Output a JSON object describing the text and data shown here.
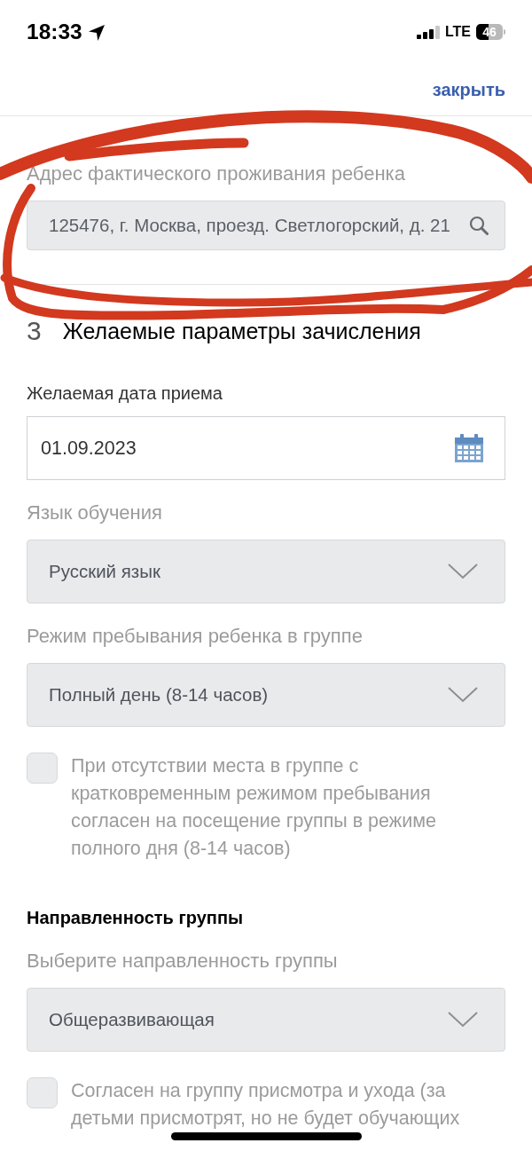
{
  "status_bar": {
    "time": "18:33",
    "network": "LTE",
    "battery": "46"
  },
  "header": {
    "close_link": "закрыть"
  },
  "address": {
    "label": "Адрес фактического проживания ребенка",
    "value": "125476, г. Москва, проезд. Светлогорский, д. 21",
    "disabled": true
  },
  "section": {
    "number": "3",
    "title": "Желаемые параметры зачисления"
  },
  "fields": [
    {
      "kind": "date",
      "label": "Желаемая дата приема",
      "value": "01.09.2023",
      "disabled": false
    },
    {
      "kind": "select",
      "label": "Язык обучения",
      "value": "Русский язык",
      "disabled": true
    },
    {
      "kind": "select",
      "label": "Режим пребывания ребенка в группе",
      "value": "Полный день (8-14 часов)",
      "disabled": true
    },
    {
      "kind": "checkbox",
      "label": "При отсутствии места в группе с кратковременным режимом пребывания согласен на посещение группы в режиме полного дня (8-14 часов)",
      "checked": false,
      "disabled": true
    },
    {
      "kind": "heading",
      "label": "Направленность группы"
    },
    {
      "kind": "select",
      "label": "Выберите направленность группы",
      "value": "Общеразвивающая",
      "disabled": true
    },
    {
      "kind": "checkbox",
      "label": "Согласен на группу присмотра и ухода (за детьми присмотрят, но не будет обучающих",
      "checked": false,
      "disabled": true
    }
  ]
}
